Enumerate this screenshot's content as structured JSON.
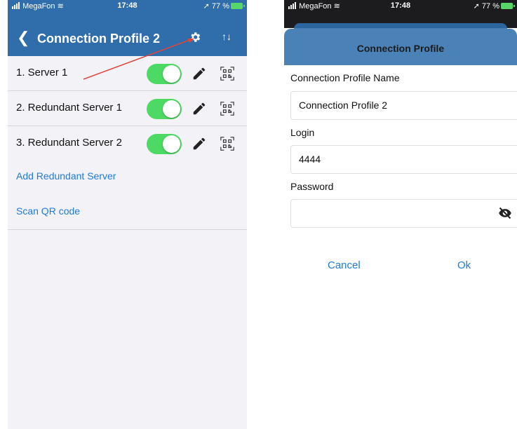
{
  "left": {
    "status": {
      "carrier": "MegaFon",
      "time": "17:48",
      "battery": "77 %"
    },
    "nav": {
      "back_icon": "chevron-left-icon",
      "title": "Connection Profile 2",
      "gear_icon": "gear-icon",
      "sort_icon": "sort-icon"
    },
    "servers": [
      {
        "label": "1. Server 1",
        "enabled": true
      },
      {
        "label": "2. Redundant Server 1",
        "enabled": true
      },
      {
        "label": "3. Redundant Server 2",
        "enabled": true
      }
    ],
    "links": {
      "add": "Add Redundant Server",
      "scan": "Scan QR code"
    },
    "colors": {
      "navbar": "#2f6eab",
      "toggle_on": "#4cd964",
      "link": "#1f7ae0",
      "annotation": "#e0453a"
    }
  },
  "right": {
    "status": {
      "carrier": "MegaFon",
      "time": "17:48",
      "battery": "77 %"
    },
    "dialog": {
      "title": "Connection Profile",
      "name_label": "Connection Profile Name",
      "name_value": "Connection Profile 2",
      "login_label": "Login",
      "login_value": "4444",
      "password_label": "Password",
      "password_value": "",
      "eye_icon": "eye-off-icon",
      "cancel": "Cancel",
      "ok": "Ok"
    }
  }
}
